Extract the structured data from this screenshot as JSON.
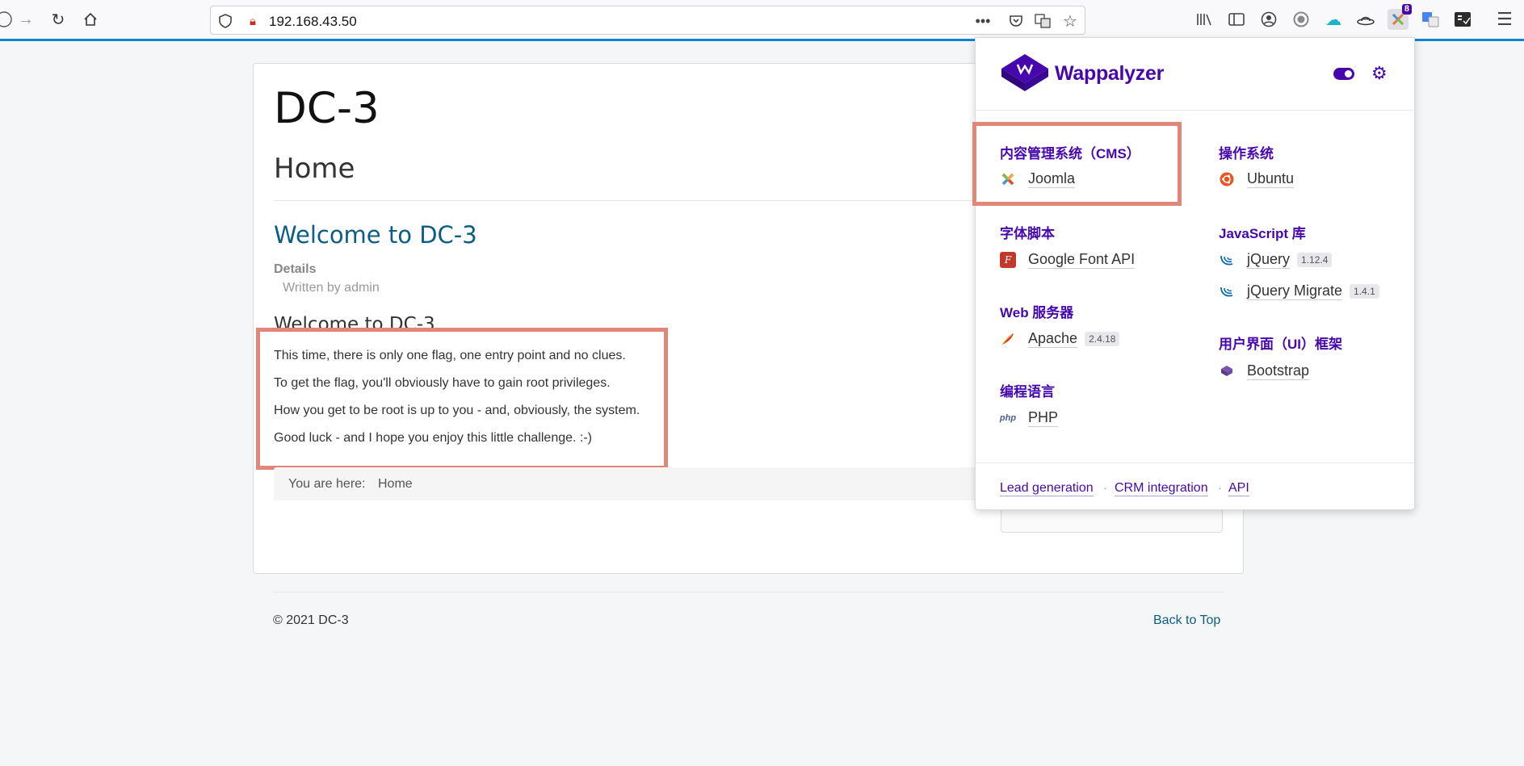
{
  "browser": {
    "url": "192.168.43.50",
    "ext_badge": "8",
    "accent_color": "#0a84d0"
  },
  "page": {
    "site_title": "DC-3",
    "heading": "Home",
    "article_title": "Welcome to DC-3",
    "details_label": "Details",
    "written_by": "Written by admin",
    "subhead": "Welcome to DC-3.",
    "paragraphs": [
      "This time, there is only one flag, one entry point and no clues.",
      "To get the flag, you'll obviously have to gain root privileges.",
      "How you get to be root is up to you - and, obviously, the system.",
      "Good luck - and I hope you enjoy this little challenge.  :-)"
    ],
    "breadcrumb_label": "You are here:",
    "breadcrumb_home": "Home",
    "copyright": "© 2021 DC-3",
    "back_to_top": "Back to Top"
  },
  "wappalyzer": {
    "brand": "Wappalyzer",
    "brand_color": "#4608ad",
    "categories": {
      "cms": "内容管理系统（CMS）",
      "os": "操作系统",
      "font": "字体脚本",
      "js": "JavaScript 库",
      "web": "Web 服务器",
      "ui": "用户界面（UI）框架",
      "lang": "编程语言"
    },
    "techs": {
      "joomla": "Joomla",
      "ubuntu": "Ubuntu",
      "gfont": "Google Font API",
      "jquery": "jQuery",
      "jquery_ver": "1.12.4",
      "jqmigrate": "jQuery Migrate",
      "jqmigrate_ver": "1.4.1",
      "apache": "Apache",
      "apache_ver": "2.4.18",
      "bootstrap": "Bootstrap",
      "php": "PHP"
    },
    "footer": {
      "lead": "Lead generation",
      "crm": "CRM integration",
      "api": "API"
    }
  },
  "annotation_color": "#e0877a"
}
